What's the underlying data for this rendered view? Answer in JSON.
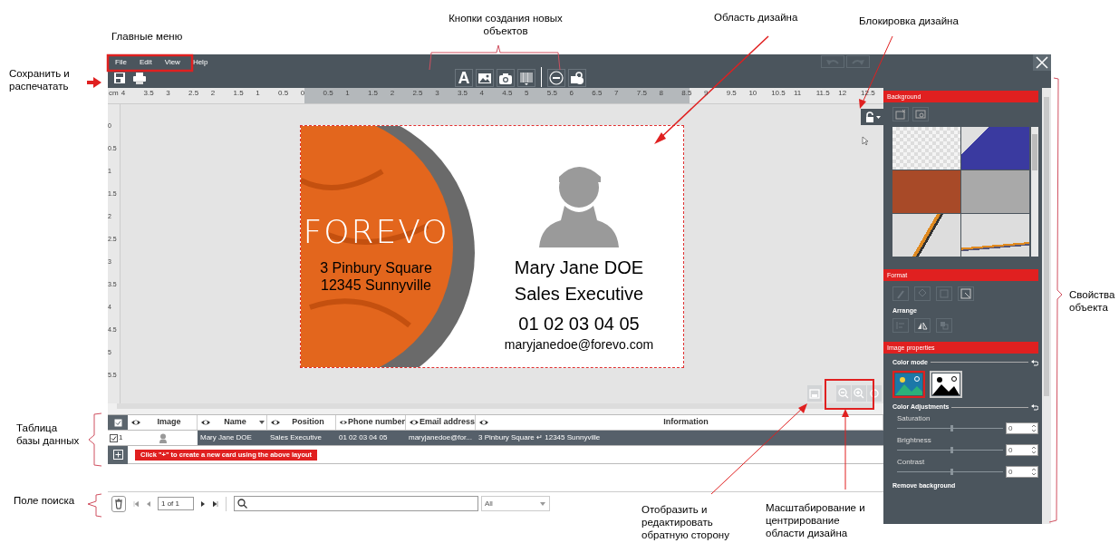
{
  "annotations": [
    {
      "text": "Главные меню"
    },
    {
      "text": "Кнопки создания новых объектов"
    },
    {
      "text": "Область дизайна"
    },
    {
      "text": "Блокировка дизайна"
    },
    {
      "text": "Сохранить и распечатать"
    },
    {
      "text": "Свойства объекта"
    },
    {
      "text": "Таблица базы данных"
    },
    {
      "text": "Поле поиска"
    },
    {
      "text": "Отобразить и редактировать обратную сторону"
    },
    {
      "text": "Масштабирование и центрирование области дизайна"
    }
  ],
  "menu": [
    {
      "label": "File"
    },
    {
      "label": "Edit"
    },
    {
      "label": "View"
    },
    {
      "label": "Help"
    }
  ],
  "toolbar": {
    "text_tool": "A"
  },
  "top_ruler": [
    "cm",
    "4",
    "3.5",
    "3",
    "2.5",
    "2",
    "1.5",
    "1",
    "0.5",
    "0",
    "0.5",
    "1",
    "1.5",
    "2",
    "2.5",
    "3",
    "3.5",
    "4",
    "4.5",
    "5",
    "5.5",
    "6",
    "6.5",
    "7",
    "7.5",
    "8",
    "8.5",
    "9",
    "9.5",
    "10",
    "10.5",
    "11",
    "11.5",
    "12",
    "12.5"
  ],
  "left_ruler": [
    "0",
    "0.5",
    "1",
    "1.5",
    "2",
    "2.5",
    "3",
    "3.5",
    "4",
    "4.5",
    "5",
    "5.5"
  ],
  "card": {
    "brand": "FOREVO",
    "address": [
      "3 Pinbury Square",
      "12345 Sunnyville"
    ],
    "name": "Mary Jane DOE",
    "position": "Sales Executive",
    "phone": "01 02 03 04 05",
    "email": "maryjanedoe@forevo.com"
  },
  "table": {
    "all_checked": true,
    "columns": [
      {
        "label": "Image",
        "dropdown": false
      },
      {
        "label": "Name",
        "dropdown": true
      },
      {
        "label": "Position",
        "dropdown": false
      },
      {
        "label": "Phone number",
        "dropdown": false
      },
      {
        "label": "Email address",
        "dropdown": false
      },
      {
        "label": "Information",
        "dropdown": false
      }
    ],
    "rows": [
      {
        "number": "1",
        "checked": true,
        "selected": true,
        "cells": [
          "",
          "Mary Jane DOE",
          "Sales Executive",
          "01 02 03 04 05",
          "maryjanedoe@for...",
          "3 Pinbury Square ↵ 12345 Sunnyville"
        ]
      }
    ],
    "add_hint": "Click \"+\" to create a new card using the above layout"
  },
  "pager": {
    "page": "1 of 1",
    "filter": "All"
  },
  "panel": {
    "background": {
      "title": "Background"
    },
    "format": {
      "title": "Format",
      "arrange": "Arrange"
    },
    "image_properties": {
      "title": "Image properties",
      "color_mode": "Color mode",
      "modes": [
        {
          "kind": "color",
          "selected": true
        },
        {
          "kind": "mono",
          "selected": false
        }
      ],
      "adjustments": "Color Adjustments",
      "sliders": [
        {
          "label": "Saturation",
          "level": 0.5,
          "value": "0"
        },
        {
          "label": "Brightness",
          "level": 0.5,
          "value": "0"
        },
        {
          "label": "Contrast",
          "level": 0.5,
          "value": "0"
        }
      ],
      "remove_background": "Remove background"
    }
  }
}
